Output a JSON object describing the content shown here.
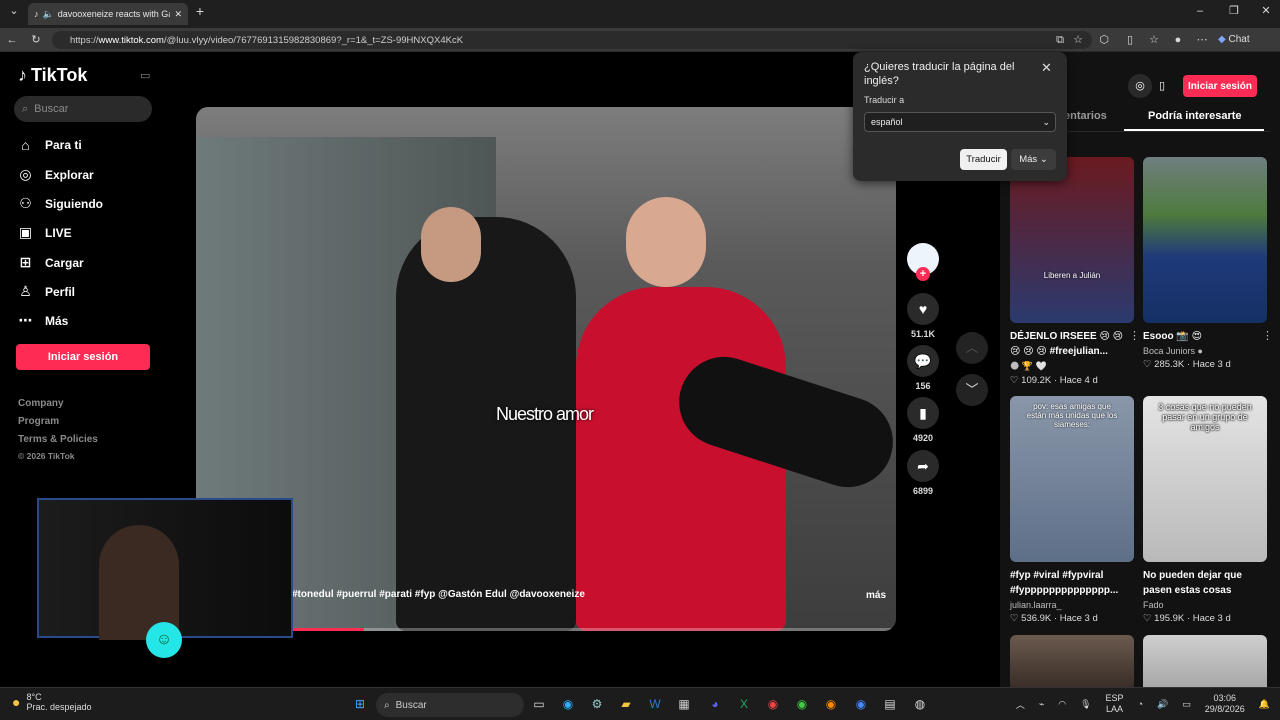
{
  "browser": {
    "tab_title": "davooxeneize reacts with Gastón...",
    "url_prefix": "https://",
    "url_domain": "www.tiktok.com",
    "url_path": "/@luu.vlyy/video/7677691315982830869?_r=1&_t=ZS-99HNXQX4KcK",
    "chat_label": "Chat"
  },
  "sidebar": {
    "logo": "TikTok",
    "search_placeholder": "Buscar",
    "nav": [
      {
        "label": "Para ti",
        "icon": "home-icon"
      },
      {
        "label": "Explorar",
        "icon": "compass-icon"
      },
      {
        "label": "Siguiendo",
        "icon": "following-icon"
      },
      {
        "label": "LIVE",
        "icon": "live-icon"
      },
      {
        "label": "Cargar",
        "icon": "upload-icon"
      },
      {
        "label": "Perfil",
        "icon": "profile-icon"
      },
      {
        "label": "Más",
        "icon": "more-icon"
      }
    ],
    "login": "Iniciar sesión",
    "footer": [
      "Company",
      "Program",
      "Terms & Policies",
      "© 2026 TikTok"
    ]
  },
  "video": {
    "caption": "Nuestro amor",
    "hashtags": "#tonedul #puerrul #parati #fyp  @Gastón Edul @davooxeneize",
    "more": "más",
    "progress": 0.12,
    "likes": "51.1K",
    "comments": "156",
    "saves": "4920",
    "shares": "6899"
  },
  "right": {
    "login": "Iniciar sesión",
    "tab_comments": "entarios",
    "tab_suggested": "Podría interesarte",
    "cards": [
      {
        "title1": "DÉJENLO IRSEEE 😢 😢",
        "title2": "😢 😢 😢 #freejulian...",
        "author": "🌑 🏆 🤍",
        "stats": "♡ 109.2K · Hace 4 d",
        "overlay": "Liberen a Julián",
        "thumb": "#7a1c22"
      },
      {
        "title1": "Esooo 📸 😍",
        "title2": "",
        "author": "Boca Juniors ●",
        "stats": "♡ 285.3K · Hace 3 d",
        "overlay": "",
        "thumb": "#2d4a6b"
      },
      {
        "title1": "#fyp #viral #fypviral",
        "title2": "#fypppppppppppppp...",
        "author": "julian.laarra_",
        "stats": "♡ 536.9K · Hace 3 d",
        "overlay": "pov: esas amigas que están más unidas que los siameses:",
        "thumb": "#7a8aa0"
      },
      {
        "title1": "No pueden dejar que",
        "title2": "pasen estas cosas",
        "author": "Fado",
        "stats": "♡ 195.9K · Hace 3 d",
        "overlay": "3 cosas que no pueden pasar en un grupo de amigos",
        "thumb": "#d8d8d8"
      }
    ]
  },
  "translate_popup": {
    "title": "¿Quieres traducir la página del inglés?",
    "subtitle": "Traducir a",
    "language": "español",
    "translate": "Traducir",
    "more": "Más"
  },
  "taskbar": {
    "temp": "8°C",
    "weather": "Prac. despejado",
    "search": "Buscar",
    "lang1": "ESP",
    "lang2": "LAA",
    "time": "03:06",
    "date": "29/8/2026"
  },
  "colors": {
    "accent": "#fe2c55",
    "background": "#000000",
    "panel": "#121212"
  }
}
